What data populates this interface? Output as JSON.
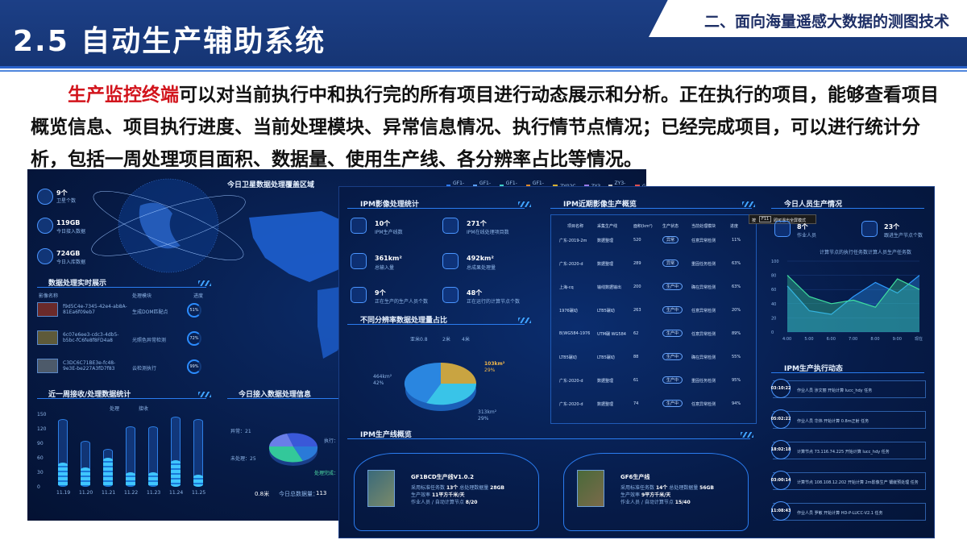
{
  "header": {
    "section": "二、面向海量遥感大数据的测图技术",
    "title": "2.5 自动生产辅助系统"
  },
  "intro": {
    "highlight": "生产监控终端",
    "text": "可以对当前执行中和执行完的所有项目进行动态展示和分析。正在执行的项目，能够查看项目概览信息、项目执行进度、当前处理模块、异常信息情况、执行情节点情况；已经完成项目，可以进行统计分析，包括一周处理项目面积、数据量、使用生产线、各分辨率占比等情况。"
  },
  "left_shot": {
    "stats": [
      {
        "value": "9个",
        "label": "卫星个数"
      },
      {
        "value": "119GB",
        "label": "今日接入数据"
      },
      {
        "value": "724GB",
        "label": "今日入库数据"
      }
    ],
    "map_title": "今日卫星数据处理覆盖区域",
    "legend": [
      "GF1-A",
      "GF1-B",
      "GF1-C",
      "GF1-D",
      "ZY02C",
      "ZY3",
      "ZY3-02",
      "GF6",
      "GF2"
    ],
    "legend_colors": [
      "#2f7bff",
      "#5aa0ff",
      "#3fd0c8",
      "#e08a2a",
      "#d8b030",
      "#9b7be8",
      "#c4c4c4",
      "#e05050",
      "#55c070"
    ],
    "realtime_title": "数据处理实时展示",
    "realtime_headers": [
      "影像名称",
      "处理模块",
      "进度"
    ],
    "realtime_rows": [
      {
        "name": "f9d5C4e-7345-42e4-ab8A-81Ea6f09eb7",
        "module": "生成DOM匹配点",
        "pct": "51%"
      },
      {
        "name": "6c07e6ee3-cdc3-4db5-b5bc-fC6fe8f8FD4a8",
        "module": "光照色异常检测",
        "pct": "72%"
      },
      {
        "name": "C3DC6C71BE3e-fc48-9e3E-be227A3fD7f83",
        "module": "云检测执行",
        "pct": "99%"
      }
    ],
    "week_title": "近一周接收/处理数据统计",
    "week_legend": [
      "处理",
      "接收"
    ],
    "week_y": [
      "150",
      "120",
      "90",
      "60",
      "30",
      "0"
    ],
    "week_x": [
      "11.19",
      "11.20",
      "11.21",
      "11.22",
      "11.23",
      "11.24",
      "11.25"
    ],
    "week_recv": [
      140,
      95,
      78,
      125,
      125,
      145,
      140
    ],
    "week_proc": [
      50,
      40,
      60,
      30,
      30,
      55,
      25
    ],
    "access_title": "今日接入数据处理信息",
    "access_labels": [
      "异常：21",
      "未处理：25",
      "执行：",
      "处理完成："
    ],
    "access_footer": [
      "0.8米",
      "今日总数据量：",
      "113"
    ]
  },
  "right_shot": {
    "ipm_title": "IPM影像处理统计",
    "ipm_stats": [
      {
        "value": "10个",
        "label": "IPM生产线数"
      },
      {
        "value": "271个",
        "label": "IPM在线处理项目数"
      },
      {
        "value": "361km²",
        "label": "总输入量"
      },
      {
        "value": "492km²",
        "label": "总成果处理量"
      },
      {
        "value": "9个",
        "label": "正在生产的生产人员个数"
      },
      {
        "value": "48个",
        "label": "正在运行的计算节点个数"
      }
    ],
    "res_title": "不同分辨率数据处理量占比",
    "res_legend": [
      "亚米0.8",
      "2米",
      "4米"
    ],
    "res_labels": [
      {
        "value": "103km²",
        "pct": "29%"
      },
      {
        "value": "464km²",
        "pct": "42%"
      },
      {
        "value": "313km²",
        "pct": "29%"
      }
    ],
    "recent_title": "IPM近期影像生产概览",
    "recent_headers": [
      "项目名称",
      "采集生产线",
      "面积(km²)",
      "生产状态",
      "当前处理模块",
      "进度"
    ],
    "recent_rows": [
      [
        "广东-2019-2m",
        "数据整理",
        "520",
        "异常",
        "任意异常检测",
        "11%"
      ],
      [
        "广东-2020-d",
        "数据整理",
        "289",
        "异常",
        "重固任务检测",
        "63%"
      ],
      [
        "上海-cq",
        "输线数据输出",
        "200",
        "生产中",
        "确在异常检测",
        "63%"
      ],
      [
        "1976碾动",
        "LTB5碾动",
        "263",
        "生产中",
        "任意异常检测",
        "20%"
      ],
      [
        "B(WG584-1976",
        "UTM碾 WG584",
        "62",
        "生产中",
        "任意异常检测",
        "89%"
      ],
      [
        "LTB5碾动",
        "LTB5碾动",
        "88",
        "生产中",
        "确在异常检测",
        "55%"
      ],
      [
        "广东-2020-d",
        "数据整理",
        "61",
        "生产中",
        "重固任务检测",
        "95%"
      ],
      [
        "广东-2020-d",
        "数据整理",
        "74",
        "生产中",
        "任意异常检测",
        "94%"
      ]
    ],
    "tooltip": {
      "key": "F11",
      "text": "即可退出全屏模式",
      "prefix": "按"
    },
    "people_title": "今日人员生产情况",
    "people_stats": [
      {
        "value": "8个",
        "label": "作业人员"
      },
      {
        "value": "23个",
        "label": "跟进生产节点个数"
      }
    ],
    "people_legend": [
      "计算节点的执行任务数",
      "计算人员生产任务数"
    ],
    "people_y": [
      "100",
      "80",
      "60",
      "40",
      "20",
      "0"
    ],
    "people_x": [
      "4:00",
      "5:00",
      "6:00",
      "7:00",
      "8:00",
      "9:00",
      "现在"
    ],
    "series_nodes": [
      65,
      30,
      25,
      50,
      70,
      55,
      80
    ],
    "series_people": [
      80,
      50,
      40,
      45,
      35,
      75,
      60
    ],
    "feed_title": "IPM生产执行动态",
    "feed": [
      {
        "time": "03:10:22",
        "text": "作业人员 涉文丽 开始计算 lucc_hdy 任务"
      },
      {
        "time": "05:02:22",
        "text": "作业人员 华炜 开始计算 0.8m正射 任务"
      },
      {
        "time": "18:02:18",
        "text": "计算节点 73.116.74.225 开始计算 lucc_hdy 任务"
      },
      {
        "time": "03:00:14",
        "text": "计算节点 108.108.12.202 开始计算 2m影像生产 镶嵌预处理 任务"
      },
      {
        "time": "11:08:43",
        "text": "作业人员 罗敏 开始计算 HD-P-LUCC-V2.1 任务"
      }
    ],
    "lines_title": "IPM生产线概览",
    "lines": [
      {
        "name": "GF1BCD生产线V1.0.2",
        "l1a": "采用标准任务数",
        "l1b": "13个",
        "l1c": "总处理数据量",
        "l1d": "28GB",
        "l2a": "生产效率",
        "l2b": "11平方千米/天",
        "l3a": "作业人员 / 自动计算节点",
        "l3b": "8/20"
      },
      {
        "name": "GF6生产线",
        "l1a": "采用标准任务数",
        "l1b": "14个",
        "l1c": "总处理数据量",
        "l1d": "56GB",
        "l2a": "生产效率",
        "l2b": "9平方千米/天",
        "l3a": "作业人员 / 自动计算节点",
        "l3b": "15/40"
      }
    ]
  }
}
